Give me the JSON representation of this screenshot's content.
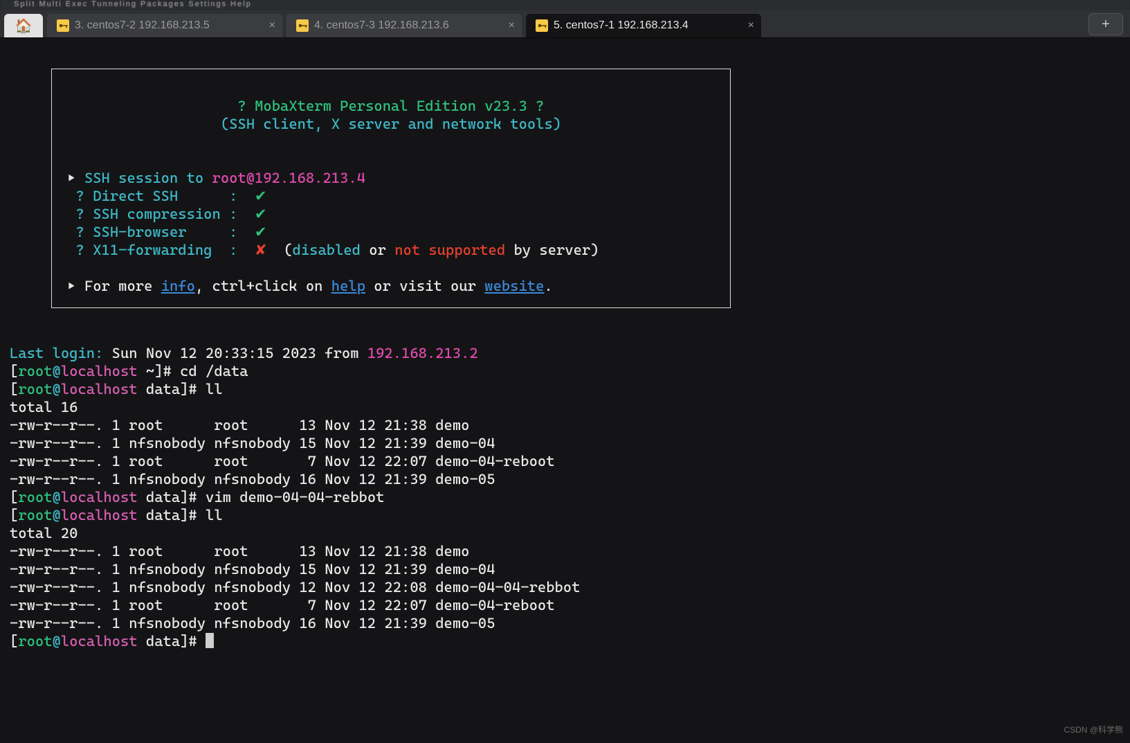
{
  "menubar_blur": "Split   Multi Exec   Tunneling   Packages   Settings        Help",
  "tabs": {
    "t2": "3. centos7-2 192.168.213.5",
    "t3": "4. centos7-3 192.168.213.6",
    "t4": "5. centos7-1 192.168.213.4"
  },
  "banner": {
    "title": "? MobaXterm Personal Edition v23.3 ?",
    "subtitle": "(SSH client, X server and network tools)",
    "ssh_session_prefix": "SSH session to ",
    "ssh_target": "root@192.168.213.4",
    "line_direct": "  ? Direct SSH      :  ",
    "line_compress": "  ? SSH compression :  ",
    "line_browser": "  ? SSH-browser     :  ",
    "line_x11": "  ? X11-forwarding  :  ",
    "x11_open": "  (",
    "x11_disabled": "disabled",
    "x11_or": " or ",
    "x11_not": "not supported",
    "x11_tail": " by server)",
    "for_more": "For more ",
    "info": "info",
    "ctrl": ", ctrl+click on ",
    "help": "help",
    "or_visit": " or visit our ",
    "website": "website",
    "dot": "."
  },
  "login": {
    "prefix": "Last login:",
    "mid": " Sun Nov 12 20:33:15 2023 from ",
    "ip": "192.168.213.2"
  },
  "prompt_parts": {
    "open": "[",
    "user": "root",
    "at": "@",
    "host": "localhost",
    "home_dir": " ~]# ",
    "data_dir": " data]# "
  },
  "cmds": {
    "cd": "cd /data",
    "ll": "ll",
    "vim": "vim demo-04-04-rebbot"
  },
  "ll1": {
    "total": "total 16",
    "r1": "-rw-r--r--. 1 root      root      13 Nov 12 21:38 demo",
    "r2": "-rw-r--r--. 1 nfsnobody nfsnobody 15 Nov 12 21:39 demo-04",
    "r3": "-rw-r--r--. 1 root      root       7 Nov 12 22:07 demo-04-reboot",
    "r4": "-rw-r--r--. 1 nfsnobody nfsnobody 16 Nov 12 21:39 demo-05"
  },
  "ll2": {
    "total": "total 20",
    "r1": "-rw-r--r--. 1 root      root      13 Nov 12 21:38 demo",
    "r2": "-rw-r--r--. 1 nfsnobody nfsnobody 15 Nov 12 21:39 demo-04",
    "r3": "-rw-r--r--. 1 nfsnobody nfsnobody 12 Nov 12 22:08 demo-04-04-rebbot",
    "r4": "-rw-r--r--. 1 root      root       7 Nov 12 22:07 demo-04-reboot",
    "r5": "-rw-r--r--. 1 nfsnobody nfsnobody 16 Nov 12 21:39 demo-05"
  },
  "watermark": "CSDN @科学熊",
  "glyph": {
    "arrow": "▸",
    "tick": "✔",
    "cross": "✘",
    "plus": "+",
    "x": "×",
    "house": "🏠"
  }
}
